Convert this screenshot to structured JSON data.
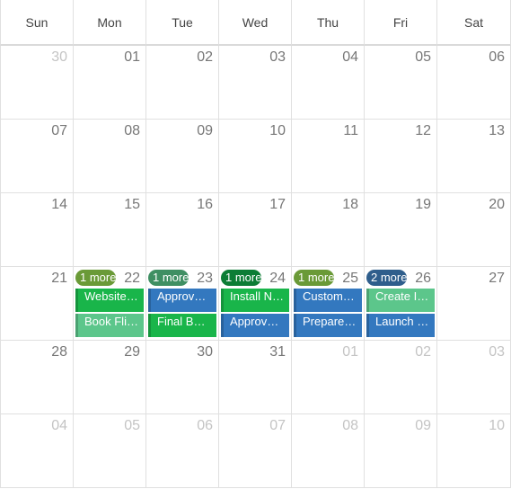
{
  "weekdays": [
    "Sun",
    "Mon",
    "Tue",
    "Wed",
    "Thu",
    "Fri",
    "Sat"
  ],
  "colors": {
    "blue": "#3378bf",
    "bright_green": "#19b54a",
    "light_green": "#5cc68b",
    "olive_green": "#6a9a37",
    "sea_green": "#3f8f63",
    "dark_green": "#0c7d35",
    "navy": "#2f5e8c"
  },
  "weeks": [
    {
      "days": [
        {
          "num": "30",
          "other": true
        },
        {
          "num": "01"
        },
        {
          "num": "02"
        },
        {
          "num": "03"
        },
        {
          "num": "04"
        },
        {
          "num": "05"
        },
        {
          "num": "06"
        }
      ]
    },
    {
      "days": [
        {
          "num": "07"
        },
        {
          "num": "08"
        },
        {
          "num": "09"
        },
        {
          "num": "10"
        },
        {
          "num": "11"
        },
        {
          "num": "12"
        },
        {
          "num": "13"
        }
      ]
    },
    {
      "days": [
        {
          "num": "14"
        },
        {
          "num": "15"
        },
        {
          "num": "16"
        },
        {
          "num": "17"
        },
        {
          "num": "18"
        },
        {
          "num": "19"
        },
        {
          "num": "20"
        }
      ]
    },
    {
      "days": [
        {
          "num": "21"
        },
        {
          "num": "22",
          "more": {
            "label": "1 more",
            "color": "olive_green"
          },
          "events": [
            {
              "label": "Website Redesign",
              "color": "bright_green"
            },
            {
              "label": "Book Flights",
              "color": "light_green"
            }
          ]
        },
        {
          "num": "23",
          "more": {
            "label": "1 more",
            "color": "sea_green"
          },
          "events": [
            {
              "label": "Approve Budget",
              "color": "blue"
            },
            {
              "label": "Final Budget Review",
              "color": "bright_green"
            }
          ]
        },
        {
          "num": "24",
          "more": {
            "label": "1 more",
            "color": "dark_green"
          },
          "events": [
            {
              "label": "Install New Database",
              "color": "bright_green"
            },
            {
              "label": "Approve Hiring",
              "color": "blue"
            }
          ]
        },
        {
          "num": "25",
          "more": {
            "label": "1 more",
            "color": "olive_green"
          },
          "events": [
            {
              "label": "Customer Meeting",
              "color": "blue"
            },
            {
              "label": "Prepare Report",
              "color": "blue"
            }
          ]
        },
        {
          "num": "26",
          "more": {
            "label": "2 more",
            "color": "navy"
          },
          "events": [
            {
              "label": "Create Invoice",
              "color": "light_green"
            },
            {
              "label": "Launch Campaign",
              "color": "blue"
            }
          ]
        },
        {
          "num": "27"
        }
      ]
    },
    {
      "days": [
        {
          "num": "28"
        },
        {
          "num": "29"
        },
        {
          "num": "30"
        },
        {
          "num": "31"
        },
        {
          "num": "01",
          "other": true
        },
        {
          "num": "02",
          "other": true
        },
        {
          "num": "03",
          "other": true
        }
      ]
    },
    {
      "days": [
        {
          "num": "04",
          "other": true
        },
        {
          "num": "05",
          "other": true
        },
        {
          "num": "06",
          "other": true
        },
        {
          "num": "07",
          "other": true
        },
        {
          "num": "08",
          "other": true
        },
        {
          "num": "09",
          "other": true
        },
        {
          "num": "10",
          "other": true
        }
      ]
    }
  ]
}
